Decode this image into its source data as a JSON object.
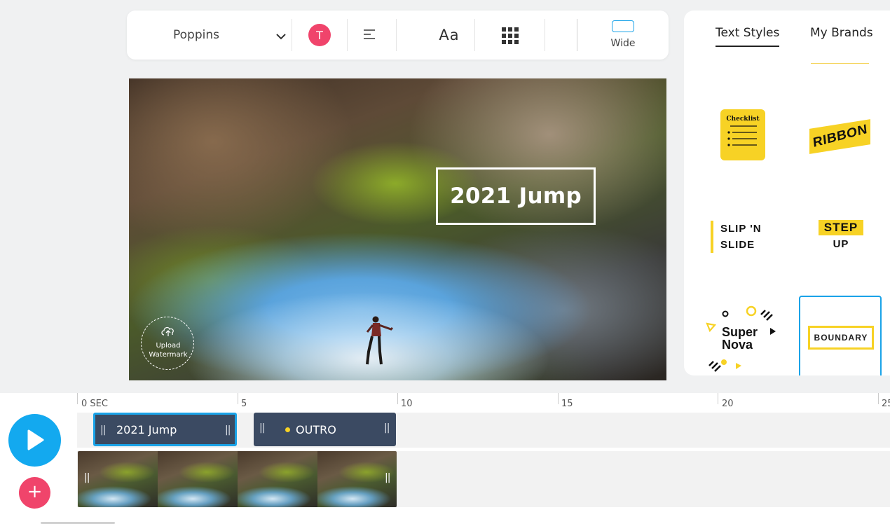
{
  "toolbar": {
    "font_name": "Poppins",
    "color_swatch_letter": "T",
    "color_swatch_color": "#f0446b",
    "text_size_label": "Aa",
    "aspect_label": "Wide",
    "icons": [
      "chevron-down-icon",
      "align-left-icon",
      "grid-icon",
      "aspect-ratio-icon"
    ]
  },
  "canvas": {
    "title_text": "2021 Jump",
    "watermark_line1": "Upload",
    "watermark_line2": "Watermark"
  },
  "panel": {
    "tabs": [
      {
        "label": "Text Styles",
        "active": true
      },
      {
        "label": "My Brands",
        "active": false
      }
    ],
    "styles": {
      "checklist": "Checklist",
      "ribbon": "RIBBON",
      "slip_line1": "SLIP 'N",
      "slip_line2": "SLIDE",
      "step_line1": "STEP",
      "step_line2": "UP",
      "nova_line1": "Super",
      "nova_line2": "Nova",
      "boundary": "BOUNDARY"
    },
    "accent_color": "#f7d225",
    "selection_color": "#1aa3e8"
  },
  "timeline": {
    "ruler": [
      "0 SEC",
      "5",
      "10",
      "15",
      "20",
      "25"
    ],
    "text_clips": [
      {
        "label": "2021 Jump",
        "selected": true
      },
      {
        "label": "OUTRO",
        "selected": false
      }
    ],
    "play_color": "#13a9ef",
    "add_color": "#f0446b"
  }
}
